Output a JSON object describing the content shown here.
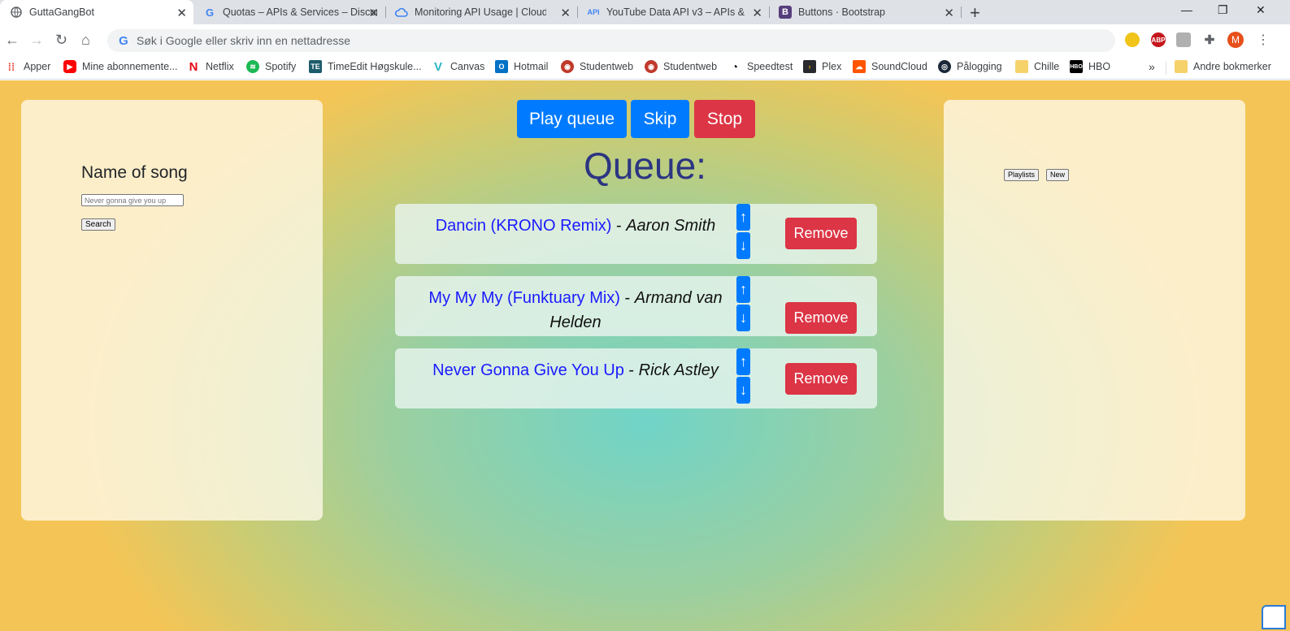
{
  "browser": {
    "tabs": [
      {
        "title": "GuttaGangBot",
        "icon": "globe-icon"
      },
      {
        "title": "Quotas – APIs & Services – Discor",
        "icon": "google-icon"
      },
      {
        "title": "Monitoring API Usage  |  Cloud A",
        "icon": "cloud-icon"
      },
      {
        "title": "YouTube Data API v3 – APIs & Se",
        "icon": "api-icon"
      },
      {
        "title": "Buttons · Bootstrap",
        "icon": "bootstrap-icon"
      }
    ],
    "omnibox_placeholder": "Søk i Google eller skriv inn en nettadresse",
    "profile_initial": "M",
    "bookmarks": [
      {
        "label": "Apper",
        "icon": "apps-grid-icon",
        "color": "#ea4335"
      },
      {
        "label": "Mine abonnemente...",
        "icon": "youtube-icon",
        "color": "#ff0000"
      },
      {
        "label": "Netflix",
        "icon": "netflix-icon",
        "color": "#e50914"
      },
      {
        "label": "Spotify",
        "icon": "spotify-icon",
        "color": "#1db954"
      },
      {
        "label": "TimeEdit Høgskule...",
        "icon": "timeedit-icon",
        "color": "#1d5c6b"
      },
      {
        "label": "Canvas",
        "icon": "canvas-icon",
        "color": "#2bb7c4"
      },
      {
        "label": "Hotmail",
        "icon": "outlook-icon",
        "color": "#0072c6"
      },
      {
        "label": "Studentweb",
        "icon": "studentweb-icon",
        "color": "#c0392b"
      },
      {
        "label": "Studentweb",
        "icon": "studentweb-icon",
        "color": "#c0392b"
      },
      {
        "label": "Speedtest",
        "icon": "speedtest-icon",
        "color": "#141526"
      },
      {
        "label": "Plex",
        "icon": "plex-icon",
        "color": "#282a2d"
      },
      {
        "label": "SoundCloud",
        "icon": "soundcloud-icon",
        "color": "#ff5500"
      },
      {
        "label": "Pålogging",
        "icon": "steam-icon",
        "color": "#1b2838"
      },
      {
        "label": "Chille",
        "icon": "folder-icon",
        "color": "#f6d26b"
      },
      {
        "label": "HBO",
        "icon": "hbo-icon",
        "color": "#000000"
      }
    ],
    "more_bookmarks": "»",
    "other_bookmarks": "Andre bokmerker"
  },
  "left_panel": {
    "label": "Name of song",
    "input_placeholder": "Never gonna give you up",
    "search_label": "Search"
  },
  "controls": {
    "play_label": "Play queue",
    "skip_label": "Skip",
    "stop_label": "Stop"
  },
  "queue_title": "Queue:",
  "queue": [
    {
      "song": "Dancin (KRONO Remix)",
      "sep": " - ",
      "artist": "Aaron Smith"
    },
    {
      "song": "My My My (Funktuary Mix)",
      "sep": " - ",
      "artist": "Armand van Helden"
    },
    {
      "song": "Never Gonna Give You Up",
      "sep": " - ",
      "artist": "Rick Astley"
    }
  ],
  "queue_item": {
    "up_arrow": "↑",
    "down_arrow": "↓",
    "remove_label": "Remove"
  },
  "right_panel": {
    "playlists_label": "Playlists",
    "new_label": "New"
  },
  "colors": {
    "primary": "#007bff",
    "danger": "#dc3545",
    "title": "#2c3582",
    "song_link": "#1a1aff"
  }
}
